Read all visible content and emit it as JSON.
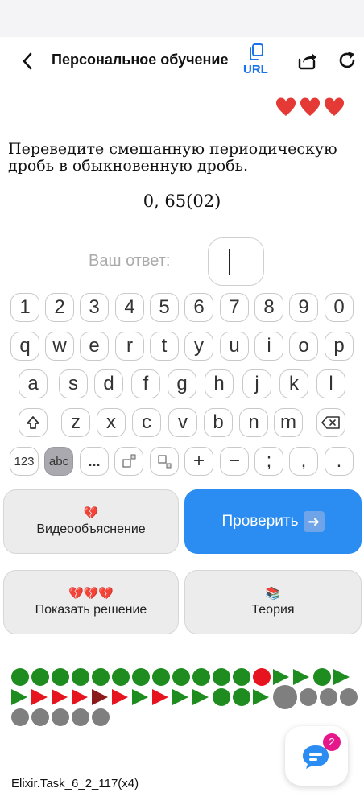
{
  "header": {
    "title": "Персональное обучение",
    "url_label": "URL"
  },
  "lives": {
    "count": 3,
    "color": "#e53935"
  },
  "task": {
    "question": "Переведите смешанную периодическую дробь в обыкновенную дробь.",
    "expression": "0, 65(02)"
  },
  "answer": {
    "label": "Ваш ответ:",
    "value": ""
  },
  "keyboard": {
    "digits": [
      "1",
      "2",
      "3",
      "4",
      "5",
      "6",
      "7",
      "8",
      "9",
      "0"
    ],
    "row1": [
      "q",
      "w",
      "e",
      "r",
      "t",
      "y",
      "u",
      "i",
      "o",
      "p"
    ],
    "row2": [
      "a",
      "s",
      "d",
      "f",
      "g",
      "h",
      "j",
      "k",
      "l"
    ],
    "row3": [
      "z",
      "x",
      "c",
      "v",
      "b",
      "n",
      "m"
    ],
    "mode_123": "123",
    "mode_abc": "abc",
    "ellipsis": "...",
    "plus": "+",
    "minus": "−",
    "semicolon": ";",
    "comma": ",",
    "period": ".",
    "selected_mode": "abc"
  },
  "buttons": {
    "video_icon": "💔",
    "video_label": "Видеообъяснение",
    "check_label": "Проверить",
    "check_icon": "➡️",
    "solution_icon": "💔💔💔",
    "solution_label": "Показать решение",
    "theory_icon": "📚",
    "theory_label": "Теория"
  },
  "progress": {
    "rows": [
      [
        "g",
        "g",
        "g",
        "g",
        "g",
        "g",
        "g",
        "g",
        "g",
        "g",
        "g",
        "g",
        "r",
        "T",
        "T",
        "g",
        "T"
      ],
      [
        "T",
        "R",
        "R",
        "R",
        "M",
        "R",
        "T",
        "R",
        "T",
        "T",
        "g",
        "g",
        "T",
        "G",
        "s",
        "s",
        "s"
      ],
      [
        "s",
        "s",
        "s",
        "s",
        "s"
      ]
    ],
    "colors": {
      "green": "#1e8c1e",
      "red": "#e5141f",
      "dark_red": "#8b1a1a",
      "gray": "#7f7f7f"
    }
  },
  "chat": {
    "badge": "2"
  },
  "footer": {
    "task_id": "Elixir.Task_6_2_117(x4)"
  }
}
